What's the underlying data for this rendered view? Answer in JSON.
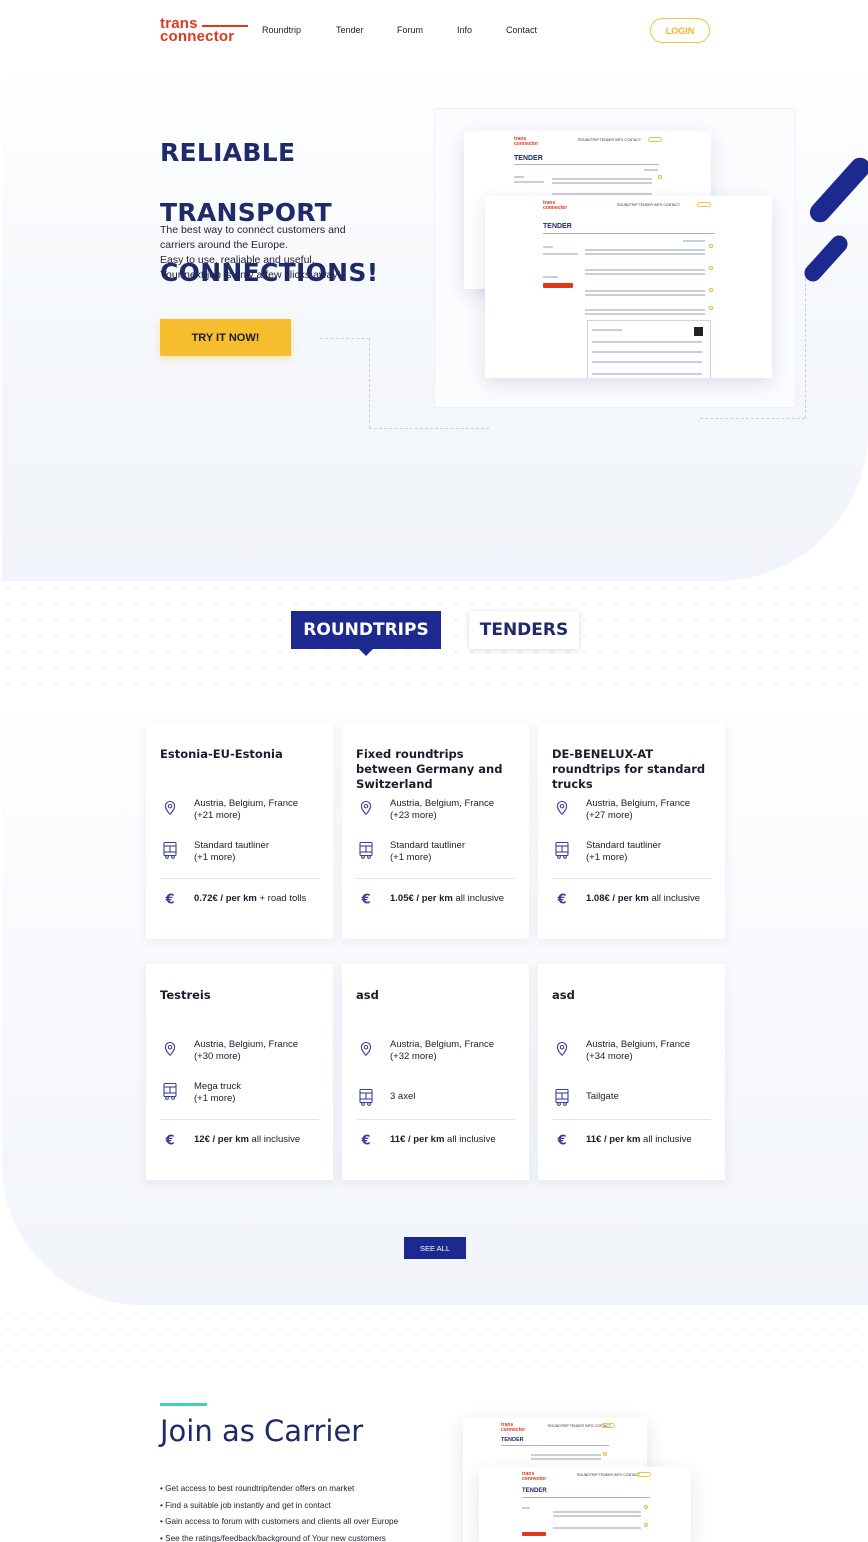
{
  "header": {
    "logo_line1": "trans",
    "logo_line2": "connector",
    "nav": [
      "Roundtrip",
      "Tender",
      "Forum",
      "Info",
      "Contact"
    ],
    "login_label": "LOGIN"
  },
  "hero": {
    "title_lines": [
      "RELIABLE",
      "TRANSPORT",
      "CONNECTIONS!"
    ],
    "text_lines": [
      "The best way to connect customers and",
      "carriers around the Europe.",
      "Easy to use, realiable and useful.",
      "Your next job is only a few clicks away!"
    ],
    "cta_label": "TRY IT NOW!",
    "mock_back": {
      "logo1": "trans",
      "logo2": "connector",
      "nav": "ROUNDTRIP TENDER INFO CONTACT",
      "title": "TENDER"
    },
    "mock_front": {
      "logo1": "trans",
      "logo2": "connector",
      "nav": "ROUNDTRIP TENDER INFO CONTACT",
      "title": "TENDER"
    }
  },
  "tabs": {
    "active": "ROUNDTRIPS",
    "inactive": "TENDERS"
  },
  "cards": [
    {
      "title": "Estonia-EU-Estonia",
      "countries": "Austria, Belgium, France",
      "countries_more": "(+21 more)",
      "truck": "Standard tautliner",
      "truck_more": "(+1 more)",
      "price": "0.72€ / per km",
      "price_note": " + road tolls"
    },
    {
      "title": "Fixed roundtrips between Germany and Switzerland",
      "countries": "Austria, Belgium, France",
      "countries_more": "(+23 more)",
      "truck": "Standard tautliner",
      "truck_more": "(+1 more)",
      "price": "1.05€ / per km",
      "price_note": " all inclusive"
    },
    {
      "title": "DE-BENELUX-AT roundtrips for standard trucks",
      "countries": "Austria, Belgium, France",
      "countries_more": "(+27 more)",
      "truck": "Standard tautliner",
      "truck_more": "(+1 more)",
      "price": "1.08€ / per km",
      "price_note": " all inclusive"
    },
    {
      "title": "Testreis",
      "countries": "Austria, Belgium, France",
      "countries_more": "(+30 more)",
      "truck": "Mega truck",
      "truck_more": "(+1 more)",
      "price": "12€ / per km",
      "price_note": " all inclusive"
    },
    {
      "title": "asd",
      "countries": "Austria, Belgium, France",
      "countries_more": "(+32 more)",
      "truck": "3 axel",
      "truck_more": "",
      "price": "11€ / per km",
      "price_note": " all inclusive"
    },
    {
      "title": "asd",
      "countries": "Austria, Belgium, France",
      "countries_more": "(+34 more)",
      "truck": "Tailgate",
      "truck_more": "",
      "price": "11€ / per km",
      "price_note": " all inclusive"
    }
  ],
  "see_all_label": "SEE ALL",
  "join": {
    "title": "Join as Carrier",
    "bullets": [
      "• Get access to best roundtrip/tender offers on market",
      "• Find a suitable job instantly and get in contact",
      "• Gain access to forum with customers and clients all over Europe",
      "• See the ratings/feedback/background of Your new customers"
    ],
    "mock_back": {
      "logo1": "trans",
      "logo2": "connector",
      "nav": "ROUNDTRIP TENDER INFO CONTACT",
      "title": "TENDER"
    },
    "mock_front": {
      "logo1": "trans",
      "logo2": "connector",
      "nav": "ROUNDTRIP TENDER INFO CONTACT",
      "title": "TENDER"
    }
  },
  "colors": {
    "brand_red": "#e3371c",
    "navy": "#1c2a8f",
    "yellow": "#f6bd2e",
    "mint": "#3fd3a5"
  }
}
